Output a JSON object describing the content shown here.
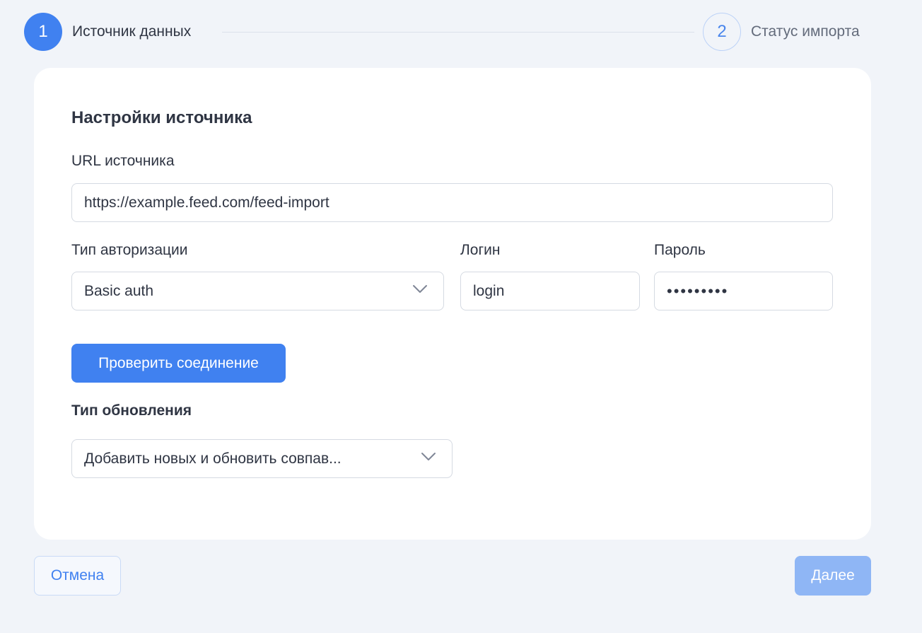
{
  "stepper": {
    "steps": [
      {
        "number": "1",
        "label": "Источник данных",
        "state": "active"
      },
      {
        "number": "2",
        "label": "Статус импорта",
        "state": "inactive"
      }
    ]
  },
  "source_settings": {
    "title": "Настройки источника",
    "url": {
      "label": "URL источника",
      "value": "https://example.feed.com/feed-import"
    },
    "auth_type": {
      "label": "Тип авторизации",
      "value": "Basic auth",
      "icon": "chevron-down-icon"
    },
    "login": {
      "label": "Логин",
      "value": "login"
    },
    "password": {
      "label": "Пароль",
      "masked_value": "•••••••••"
    },
    "check_button_label": "Проверить соединение",
    "update_type": {
      "label": "Тип обновления",
      "value": "Добавить новых и обновить совпав...",
      "icon": "chevron-down-icon"
    }
  },
  "footer": {
    "cancel_label": "Отмена",
    "next_label": "Далее"
  },
  "colors": {
    "accent": "#4081f0",
    "accent_disabled": "#8fb6f5",
    "background": "#f1f4f9",
    "card": "#ffffff",
    "text": "#2f3543"
  }
}
